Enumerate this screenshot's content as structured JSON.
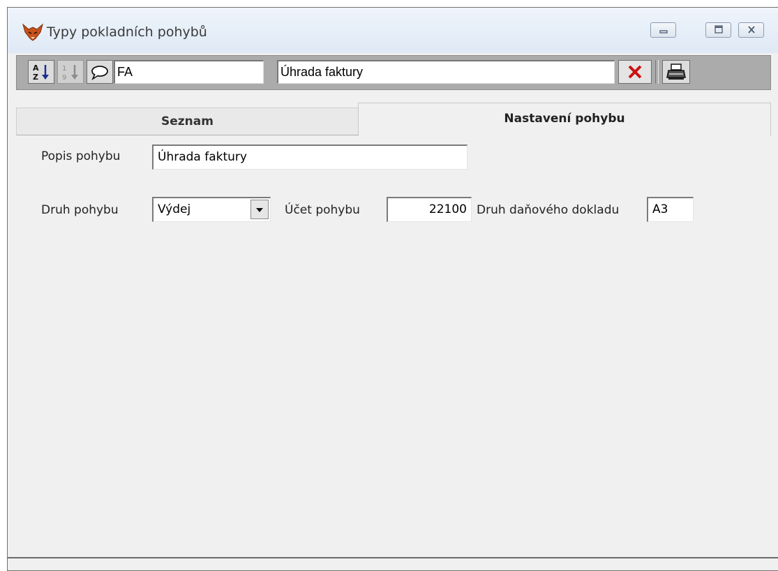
{
  "window": {
    "title": "Typy pokladních pohybů"
  },
  "toolbar": {
    "code_value": "FA",
    "description_value": "Úhrada faktury"
  },
  "tabs": [
    {
      "label": "Seznam",
      "active": false
    },
    {
      "label": "Nastavení pohybu",
      "active": true
    }
  ],
  "form": {
    "popis_label": "Popis pohybu",
    "popis_value": "Úhrada faktury",
    "druh_label": "Druh pohybu",
    "druh_value": "Výdej",
    "ucet_label": "Účet pohybu",
    "ucet_value": "22100",
    "danovy_label": "Druh daňového dokladu",
    "danovy_value": "A3"
  },
  "icons": [
    "app-fox-icon",
    "sort-az-icon",
    "sort-numeric-icon",
    "comment-icon",
    "delete-x-icon",
    "print-icon",
    "minimize-icon",
    "restore-icon",
    "close-icon",
    "dropdown-arrow-icon"
  ],
  "colors": {
    "delete_red": "#cc1111",
    "toolbar_bg": "#ababab",
    "titlebar": "#e4edf7"
  }
}
